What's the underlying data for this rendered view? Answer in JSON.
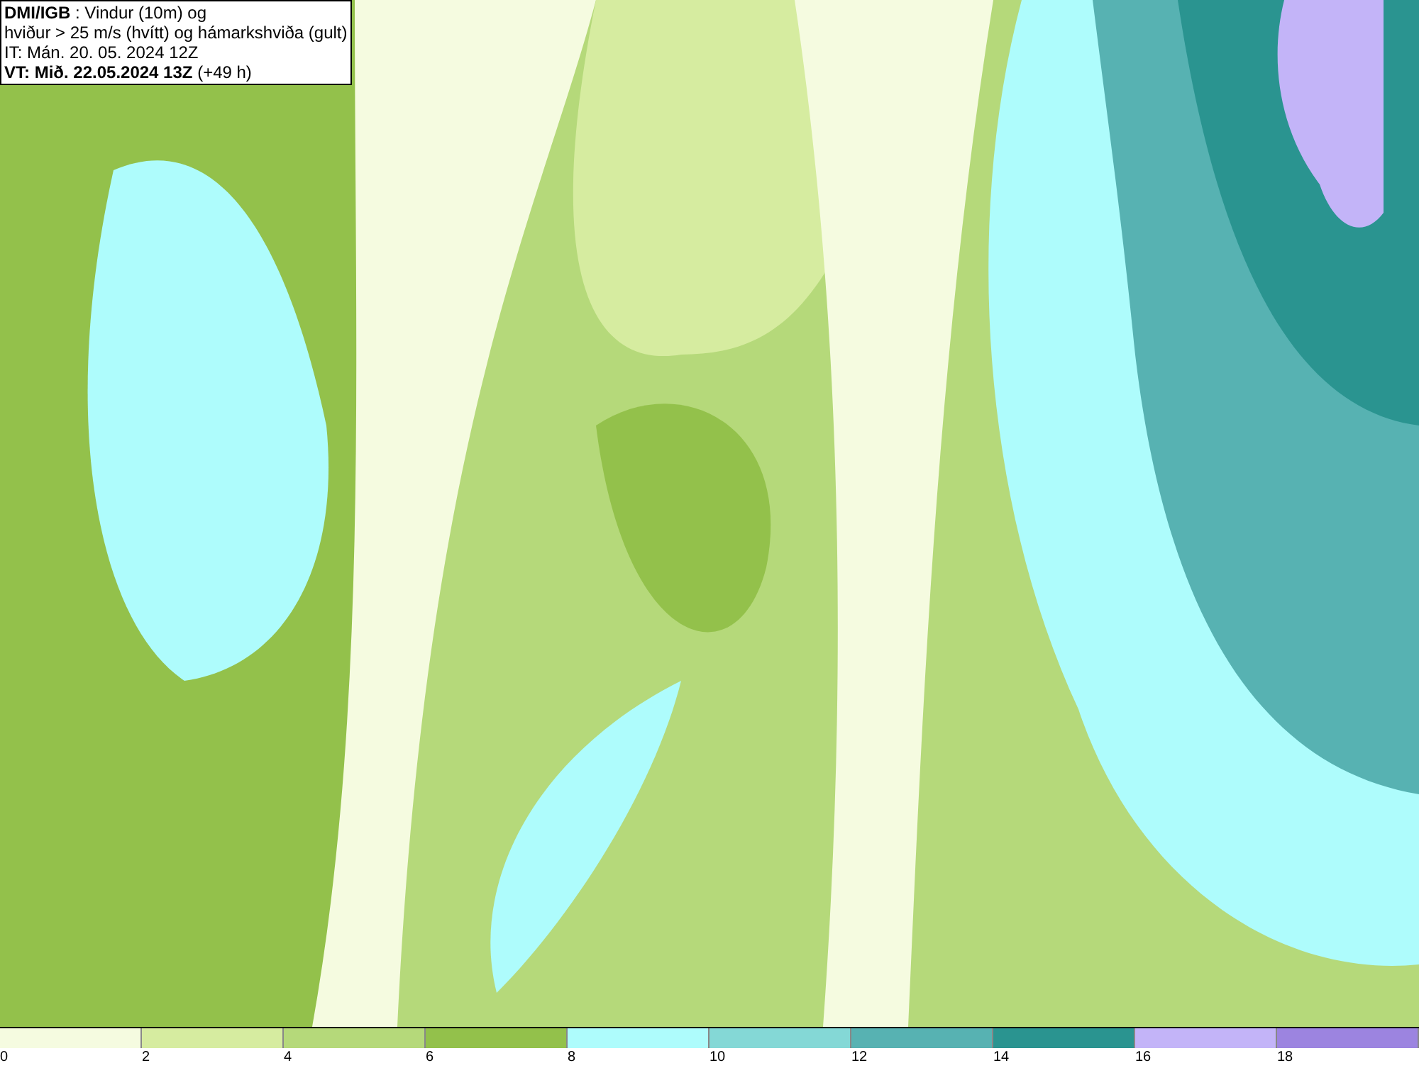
{
  "title_box": {
    "lines": [
      "**DMI/IGB** : Vindur (10m) og",
      "hviður > 25 m/s (hvítt) og hámarkshviða (gult)",
      "IT: Mán. 20. 05. 2024 12Z",
      "**VT: Mið. 22.05.2024 13Z** (+49 h)"
    ]
  },
  "legend": [
    {
      "label": "0",
      "color": "#f5fbe0"
    },
    {
      "label": "2",
      "color": "#d6eca0"
    },
    {
      "label": "4",
      "color": "#b5d97a"
    },
    {
      "label": "6",
      "color": "#93c14b"
    },
    {
      "label": "8",
      "color": "#aefcfc"
    },
    {
      "label": "10",
      "color": "#84d8d6"
    },
    {
      "label": "12",
      "color": "#57b2b2"
    },
    {
      "label": "14",
      "color": "#2a9490"
    },
    {
      "label": "16",
      "color": "#c3b4f8"
    },
    {
      "label": "18",
      "color": "#9c84e0"
    }
  ]
}
